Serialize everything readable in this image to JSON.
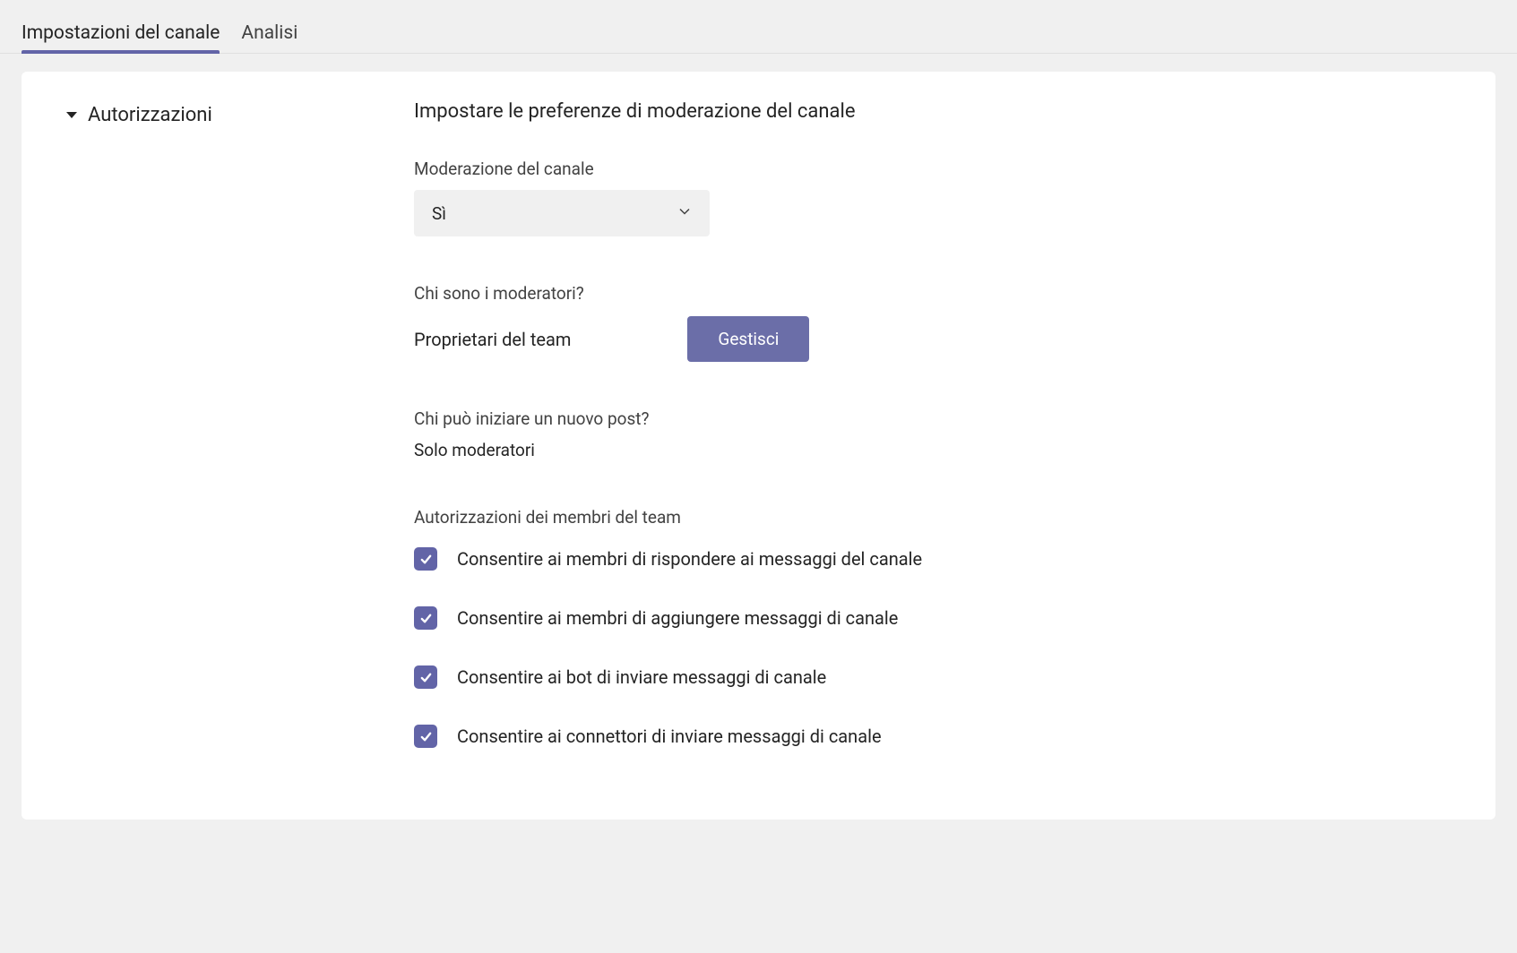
{
  "tabs": {
    "channel_settings": "Impostazioni del canale",
    "analytics": "Analisi"
  },
  "section": {
    "title": "Autorizzazioni",
    "heading": "Impostare le preferenze di moderazione del canale"
  },
  "moderation": {
    "label": "Moderazione del canale",
    "value": "Sì"
  },
  "moderators": {
    "label": "Chi sono i moderatori?",
    "value": "Proprietari del team",
    "manage_button": "Gestisci"
  },
  "new_post": {
    "label": "Chi può iniziare un nuovo post?",
    "value": "Solo moderatori"
  },
  "permissions": {
    "heading": "Autorizzazioni dei membri del team",
    "items": [
      {
        "label": "Consentire ai membri di rispondere ai messaggi del canale",
        "checked": true
      },
      {
        "label": "Consentire ai membri di aggiungere messaggi di canale",
        "checked": true
      },
      {
        "label": "Consentire ai bot di inviare messaggi di canale",
        "checked": true
      },
      {
        "label": "Consentire ai connettori di inviare messaggi di canale",
        "checked": true
      }
    ]
  }
}
